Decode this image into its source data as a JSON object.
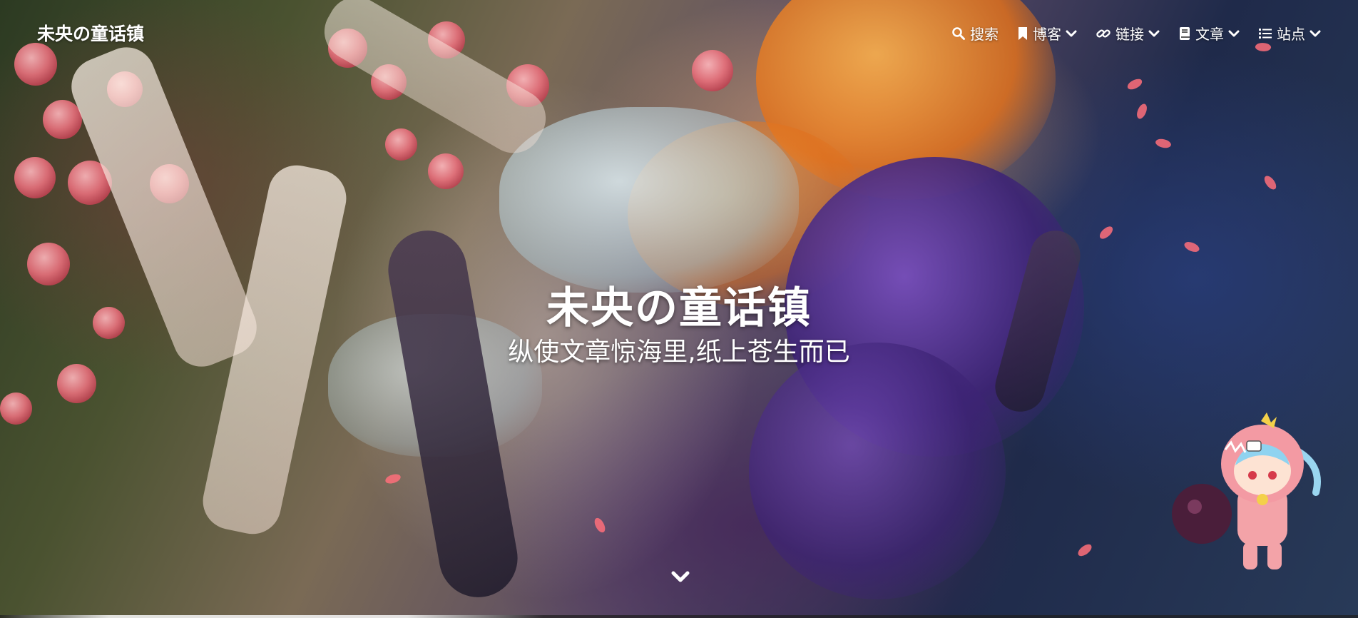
{
  "header": {
    "site_title": "未央の童话镇"
  },
  "menu": {
    "items": [
      {
        "label": "搜索",
        "icon": "search-icon",
        "has_dropdown": false
      },
      {
        "label": "博客",
        "icon": "bookmark-icon",
        "has_dropdown": true
      },
      {
        "label": "链接",
        "icon": "link-icon",
        "has_dropdown": true
      },
      {
        "label": "文章",
        "icon": "book-icon",
        "has_dropdown": true
      },
      {
        "label": "站点",
        "icon": "list-icon",
        "has_dropdown": true
      }
    ]
  },
  "hero": {
    "title": "未央の童话镇",
    "subtitle": "纵使文章惊海里,纸上苍生而已",
    "scroll_icon": "chevron-down-icon",
    "background": "anime-illustration"
  },
  "mascot": {
    "icon": "mascot-character"
  },
  "colors": {
    "text": "#ffffff"
  }
}
